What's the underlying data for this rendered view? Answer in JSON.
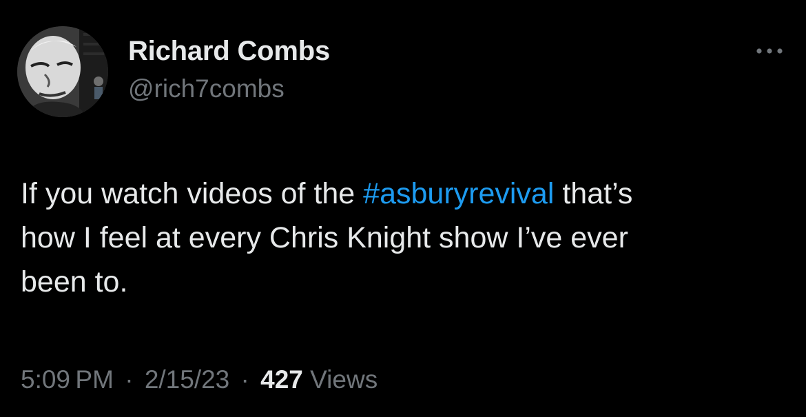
{
  "author": {
    "display_name": "Richard Combs",
    "handle": "@rich7combs",
    "avatar_icon": "profile-photo"
  },
  "more_icon": "ellipsis-icon",
  "tweet": {
    "line1_pre": "If you watch videos of the ",
    "hashtag": "#asburyrevival",
    "line1_post": " that’s",
    "line2": "how I feel at every Chris Knight show I’ve ever",
    "line3": "been to."
  },
  "meta": {
    "time": "5:09 PM",
    "separator": "·",
    "date": "2/15/23",
    "views_count": "427",
    "views_label": "Views"
  },
  "colors": {
    "background": "#000000",
    "primary_text": "#e7e9ea",
    "secondary_text": "#71767b",
    "link": "#1d9bf0"
  }
}
